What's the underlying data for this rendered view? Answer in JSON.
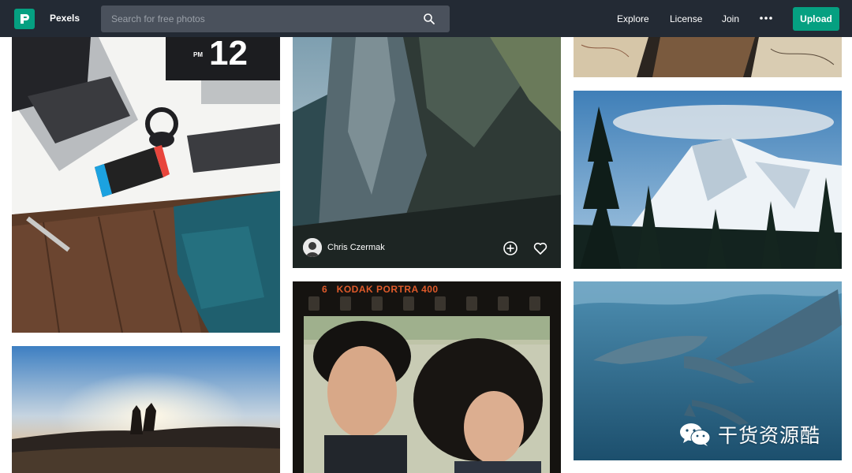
{
  "nav": {
    "brand": "Pexels",
    "search_placeholder": "Search for free photos",
    "links": [
      "Explore",
      "License",
      "Join"
    ],
    "more_icon": "ellipsis-icon",
    "upload_label": "Upload",
    "accent": "#05a081",
    "background": "#232a34"
  },
  "photos": {
    "featured": {
      "photographer": "Chris Czermak",
      "actions": [
        "plus-circle-icon",
        "heart-icon"
      ]
    },
    "film_caption": "6   KODAK PORTRA 400",
    "clock_text": "12",
    "clock_pm": "PM"
  },
  "watermark": {
    "text": "干货资源酷",
    "icon": "wechat-icon"
  }
}
